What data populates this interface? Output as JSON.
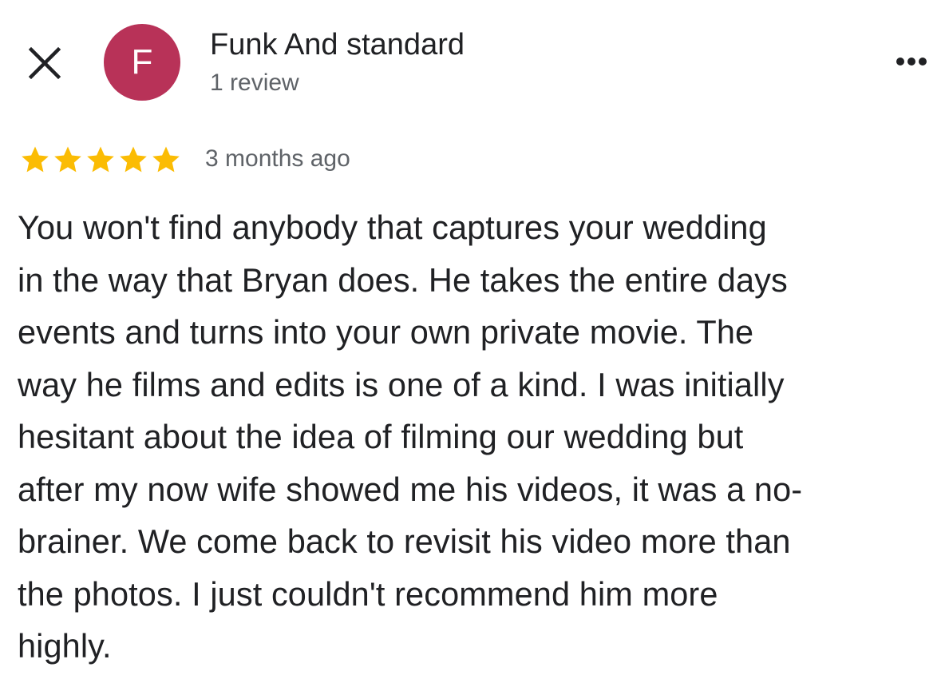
{
  "header": {
    "close_icon": "close-icon",
    "more_icon": "more-horizontal-icon",
    "author": {
      "initial": "F",
      "avatar_color": "#b83258",
      "name": "Funk And standard",
      "review_count": "1 review"
    }
  },
  "review": {
    "rating": 5,
    "rating_max": 5,
    "star_color": "#fbbc04",
    "time": "3 months ago",
    "text_lines": [
      "You won't find anybody that captures your wedding",
      "in the way that Bryan does. He takes the entire days",
      "events and turns into your own private movie. The",
      "way he films and edits is one of a kind. I was initially",
      "hesitant about the idea of filming our wedding but",
      "after my now wife showed me his videos, it was a no-",
      "brainer. We come back to revisit his video more than",
      "the photos. I just couldn't recommend him more",
      "highly."
    ]
  }
}
